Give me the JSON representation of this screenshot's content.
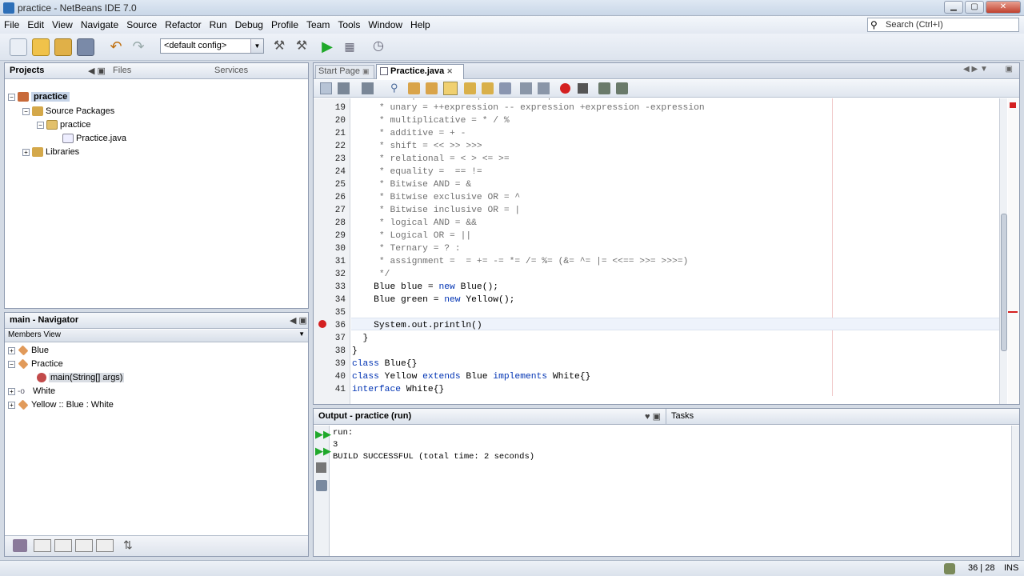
{
  "window": {
    "title": "practice - NetBeans IDE 7.0"
  },
  "menubar": [
    "File",
    "Edit",
    "View",
    "Navigate",
    "Source",
    "Refactor",
    "Run",
    "Debug",
    "Profile",
    "Team",
    "Tools",
    "Window",
    "Help"
  ],
  "search": {
    "placeholder": "Search (Ctrl+I)"
  },
  "toolbar": {
    "config": "<default config>"
  },
  "projects_panel": {
    "tabs": [
      "Projects",
      "Files",
      "Services"
    ],
    "tree": [
      {
        "label": "practice"
      },
      {
        "label": "Source Packages"
      },
      {
        "label": "practice"
      },
      {
        "label": "Practice.java"
      },
      {
        "label": "Libraries"
      }
    ]
  },
  "navigator": {
    "title": "main - Navigator",
    "view": "Members View",
    "items": [
      {
        "label": "Blue"
      },
      {
        "label": "Practice"
      },
      {
        "label": "main(String[] args)"
      },
      {
        "label": "White"
      },
      {
        "label": "Yellow :: Blue : White"
      }
    ]
  },
  "editor": {
    "tabs": [
      "Start Page",
      "Practice.java"
    ],
    "lines": [
      {
        "n": "19",
        "code": "     * unary = ++expression -- expression +expression -expression"
      },
      {
        "n": "20",
        "code": "     * multiplicative = * / %"
      },
      {
        "n": "21",
        "code": "     * additive = + -"
      },
      {
        "n": "22",
        "code": "     * shift = << >> >>>"
      },
      {
        "n": "23",
        "code": "     * relational = < > <= >="
      },
      {
        "n": "24",
        "code": "     * equality =  == !="
      },
      {
        "n": "25",
        "code": "     * Bitwise AND = &"
      },
      {
        "n": "26",
        "code": "     * Bitwise exclusive OR = ^"
      },
      {
        "n": "27",
        "code": "     * Bitwise inclusive OR = |"
      },
      {
        "n": "28",
        "code": "     * logical AND = &&"
      },
      {
        "n": "29",
        "code": "     * Logical OR = ||"
      },
      {
        "n": "30",
        "code": "     * Ternary = ? :"
      },
      {
        "n": "31",
        "code": "     * assignment =  = += -= *= /= %= (&= ^= |= <<== >>= >>>=)"
      },
      {
        "n": "32",
        "code": "     */"
      },
      {
        "n": "33",
        "code": "    Blue blue = new Blue();"
      },
      {
        "n": "34",
        "code": "    Blue green = new Yellow();"
      },
      {
        "n": "35",
        "code": ""
      },
      {
        "n": "36",
        "code": "    System.out.println()"
      },
      {
        "n": "37",
        "code": "  }"
      },
      {
        "n": "38",
        "code": "}"
      },
      {
        "n": "39",
        "code": "class Blue{}"
      },
      {
        "n": "40",
        "code": "class Yellow extends Blue implements White{}"
      },
      {
        "n": "41",
        "code": "interface White{}"
      }
    ]
  },
  "output": {
    "title": "Output - practice (run)",
    "tasks_tab": "Tasks",
    "lines": [
      "run:",
      "3",
      "BUILD SUCCESSFUL (total time: 2 seconds)"
    ]
  },
  "status": {
    "position": "36 | 28",
    "mode": "INS"
  },
  "colors": {
    "accent": "#3b6ea5",
    "error": "#d42020",
    "highlight": "#fff36b"
  }
}
